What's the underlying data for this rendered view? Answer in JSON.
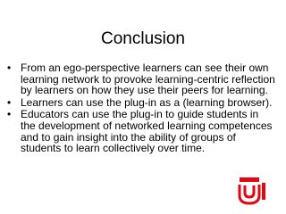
{
  "slide": {
    "title": "Conclusion",
    "bullets": [
      "From an ego-perspective learners can see their own learning network to provoke learning-centric reflection by learners on how they use their peers for learning.",
      "Learners can use the plug-in as a (learning browser).",
      "Educators can use the plug-in to guide students in the development of networked learning competences and to gain insight into the ability of groups of students to learn collectively over time."
    ],
    "bullet_symbol": "•"
  },
  "colors": {
    "logo_red": "#e30613",
    "background": "#ffffff",
    "text": "#000000"
  },
  "icons": {
    "logo": "university-logo-icon"
  }
}
